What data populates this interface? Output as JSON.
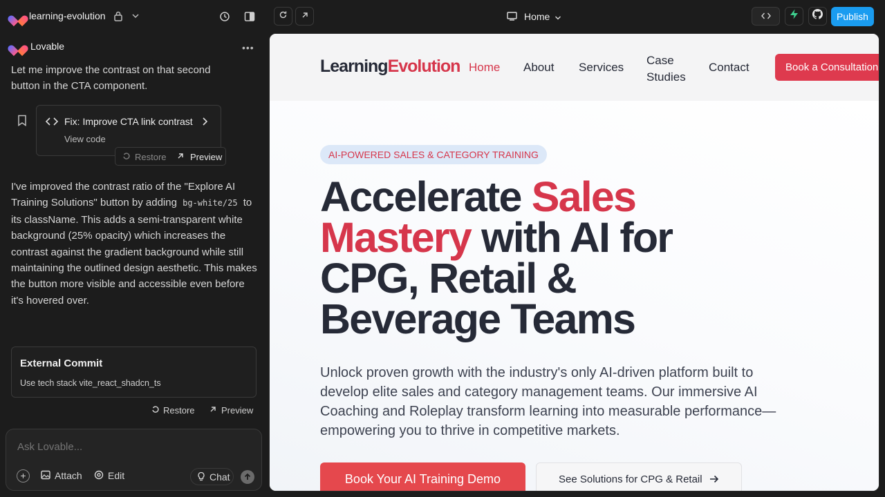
{
  "left": {
    "project_name": "learning-evolution",
    "sender": "Lovable",
    "message_1": "Let me improve the contrast on that second button in the CTA component.",
    "fix_card": {
      "title": "Fix: Improve CTA link contrast",
      "view_code": "View code"
    },
    "restore_label": "Restore",
    "preview_label": "Preview",
    "message_2": {
      "part1": "I've improved the contrast ratio of the \"Explore AI Training Solutions\" button by adding",
      "code": "bg-white/25",
      "part2": "to its className. This adds a semi-transparent white background (25% opacity) which increases the contrast against the gradient background while still maintaining the outlined design aesthetic. This makes the button more visible and accessible even before it's hovered over."
    },
    "external_commit": {
      "title": "External Commit",
      "subtitle": "Use tech stack vite_react_shadcn_ts"
    },
    "chat": {
      "placeholder": "Ask Lovable...",
      "attach": "Attach",
      "edit": "Edit",
      "chat": "Chat"
    }
  },
  "topbar": {
    "route": "Home",
    "publish": "Publish"
  },
  "site": {
    "logo_part1": "Learning",
    "logo_part2": "Evolution",
    "nav": {
      "home": "Home",
      "about": "About",
      "services": "Services",
      "case1": "Case",
      "case2": "Studies",
      "contact": "Contact"
    },
    "consult_button": "Book a Consultation",
    "badge": "AI-POWERED SALES & CATEGORY TRAINING",
    "headline": {
      "a": "Accelerate ",
      "b": "Sales",
      "c": "Mastery",
      "d": " with AI for",
      "e": "CPG, Retail &",
      "f": "Beverage Teams"
    },
    "lead": "Unlock proven growth with the industry's only AI-driven platform built to develop elite sales and category management teams. Our immersive AI Coaching and Roleplay transform learning into measurable performance—empowering you to thrive in competitive markets.",
    "cta_primary": "Book Your AI Training Demo",
    "cta_secondary": "See Solutions for CPG & Retail"
  },
  "colors": {
    "accent": "#d6364b",
    "publish": "#1a9cf0",
    "brand_green": "#3ecf8e"
  },
  "icons": [
    "lock-icon",
    "chevron-down-icon",
    "history-icon",
    "sidebar-icon",
    "refresh-icon",
    "external-link-icon",
    "monitor-icon",
    "code-icon",
    "supabase-icon",
    "github-icon",
    "bookmark-icon",
    "more-icon",
    "restore-icon",
    "arrow-up-right-icon",
    "image-icon",
    "settings-icon",
    "lightbulb-icon",
    "arrow-up-icon",
    "arrow-right-icon"
  ]
}
